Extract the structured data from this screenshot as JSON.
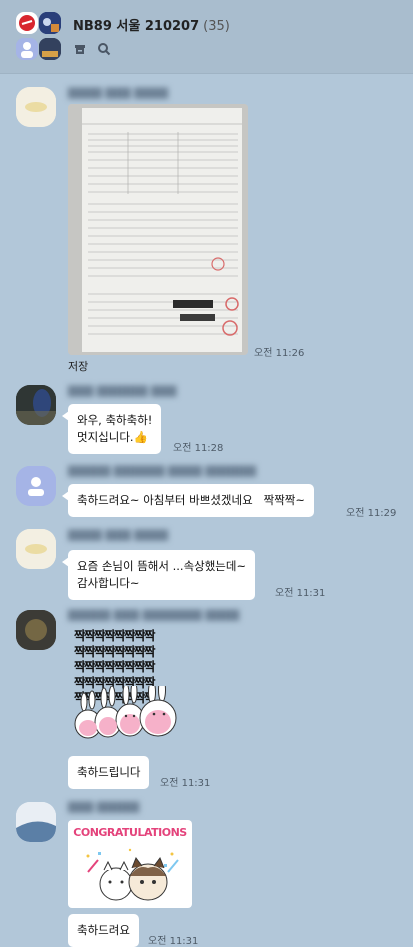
{
  "header": {
    "title": "NB89 서울 210207",
    "count": "(35)",
    "icons": [
      "archive-icon",
      "search-icon"
    ]
  },
  "messages": [
    {
      "id": "m1",
      "type": "image",
      "time": "오전 11:26",
      "caption": "저장"
    },
    {
      "id": "m2",
      "type": "text",
      "text": "와우, 축하축하!\n멋지십니다.👍",
      "time": "오전 11:28"
    },
    {
      "id": "m3",
      "type": "text",
      "text": "축하드려요~ 아침부터 바쁘셨겠네요   짝짝짝~",
      "time": "오전 11:29"
    },
    {
      "id": "m4",
      "type": "text",
      "text": "요즘 손님이 뜸해서 ...속상했는데~\n감사합니다~",
      "time": "오전 11:31"
    },
    {
      "id": "m5",
      "type": "sticker",
      "sticker_text": "짝짝짝짝짝짝짝짝",
      "text": "축하드립니다",
      "time": "오전 11:31"
    },
    {
      "id": "m6",
      "type": "sticker",
      "sticker_text": "CONGRATULATIONS",
      "text": "축하드려요",
      "time": "오전 11:31"
    }
  ],
  "doc": {
    "title": "아파트 매매 계약서"
  },
  "colors": {
    "background": "#b2c7d9",
    "header": "#a9bdce",
    "bubble": "#ffffff"
  }
}
